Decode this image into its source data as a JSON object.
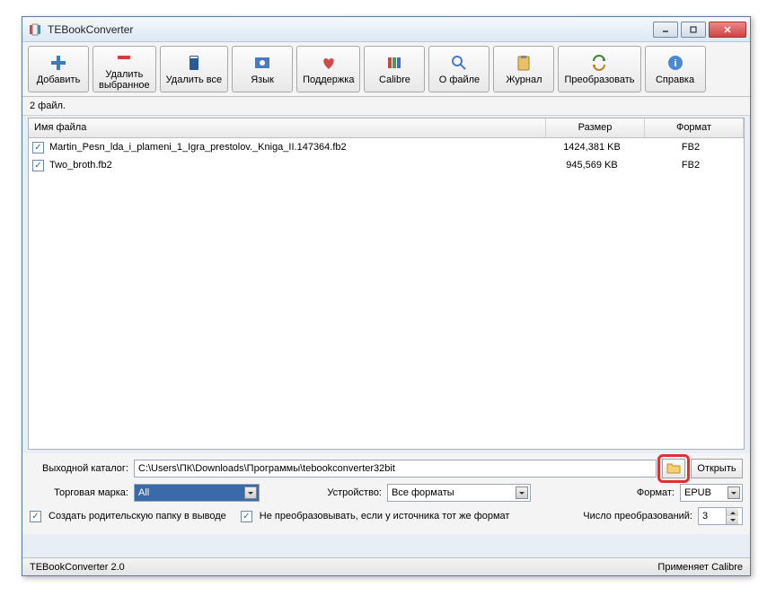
{
  "window": {
    "title": "TEBookConverter"
  },
  "toolbar": {
    "add": "Добавить",
    "remove_sel": "Удалить\nвыбранное",
    "remove_all": "Удалить все",
    "language": "Язык",
    "support": "Поддержка",
    "calibre": "Calibre",
    "about_file": "О файле",
    "journal": "Журнал",
    "convert": "Преобразовать",
    "help": "Справка"
  },
  "count_label": "2 файл.",
  "columns": {
    "name": "Имя файла",
    "size": "Размер",
    "format": "Формат"
  },
  "files": [
    {
      "checked": true,
      "name": "Martin_Pesn_lda_i_plameni_1_Igra_prestolov._Kniga_II.147364.fb2",
      "size": "1424,381 KB",
      "format": "FB2"
    },
    {
      "checked": true,
      "name": "Two_broth.fb2",
      "size": "945,569 KB",
      "format": "FB2"
    }
  ],
  "bottom": {
    "out_label": "Выходной каталог:",
    "out_path": "C:\\Users\\ПК\\Downloads\\Программы\\tebookconverter32bit",
    "open_btn": "Открыть",
    "brand_label": "Торговая марка:",
    "brand_value": "All",
    "device_label": "Устройство:",
    "device_value": "Все форматы",
    "format_label": "Формат:",
    "format_value": "EPUB",
    "create_parent": "Создать родительскую папку в выводе",
    "skip_same": "Не преобразовывать, если у источника тот же формат",
    "conv_count_label": "Число преобразований:",
    "conv_count": "3"
  },
  "status": {
    "left": "TEBookConverter 2.0",
    "right": "Применяет Calibre"
  }
}
